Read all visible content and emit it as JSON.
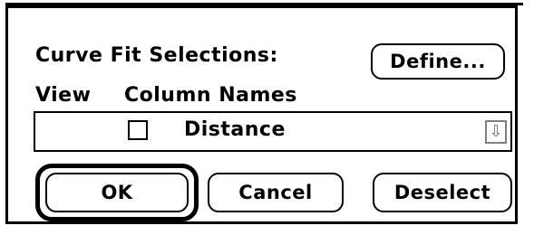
{
  "dialog": {
    "title": "Curve Fit Selections:",
    "define_label": "Define...",
    "view_label": "View",
    "column_names_label": "Column Names",
    "list": {
      "items": [
        {
          "label": "Distance",
          "checked": false
        }
      ],
      "scroll_icon": "scroll-down-arrow"
    },
    "buttons": {
      "ok": "OK",
      "cancel": "Cancel",
      "deselect": "Deselect"
    }
  }
}
